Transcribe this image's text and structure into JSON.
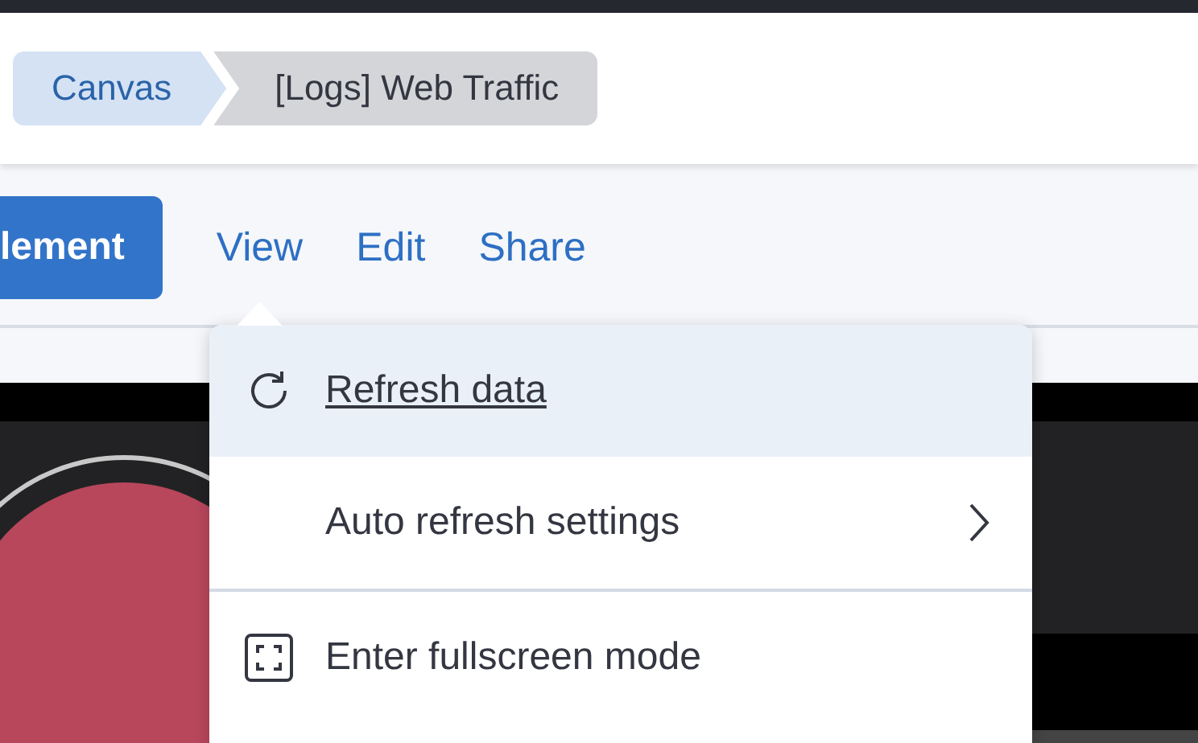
{
  "breadcrumbs": [
    {
      "label": "Canvas",
      "selected": false
    },
    {
      "label": "[Logs] Web Traffic",
      "selected": true
    }
  ],
  "toolbar": {
    "primary_button": "lement",
    "menus": [
      {
        "label": "View",
        "selected": true
      },
      {
        "label": "Edit",
        "selected": false
      },
      {
        "label": "Share",
        "selected": false
      }
    ]
  },
  "menu": {
    "items": [
      {
        "kind": "refresh",
        "label": "Refresh data",
        "selected": true
      },
      {
        "kind": "submenu",
        "label": "Auto refresh settings",
        "selected": false
      },
      {
        "kind": "separator"
      },
      {
        "kind": "fullscreen",
        "label": "Enter fullscreen mode",
        "selected": false
      }
    ]
  }
}
